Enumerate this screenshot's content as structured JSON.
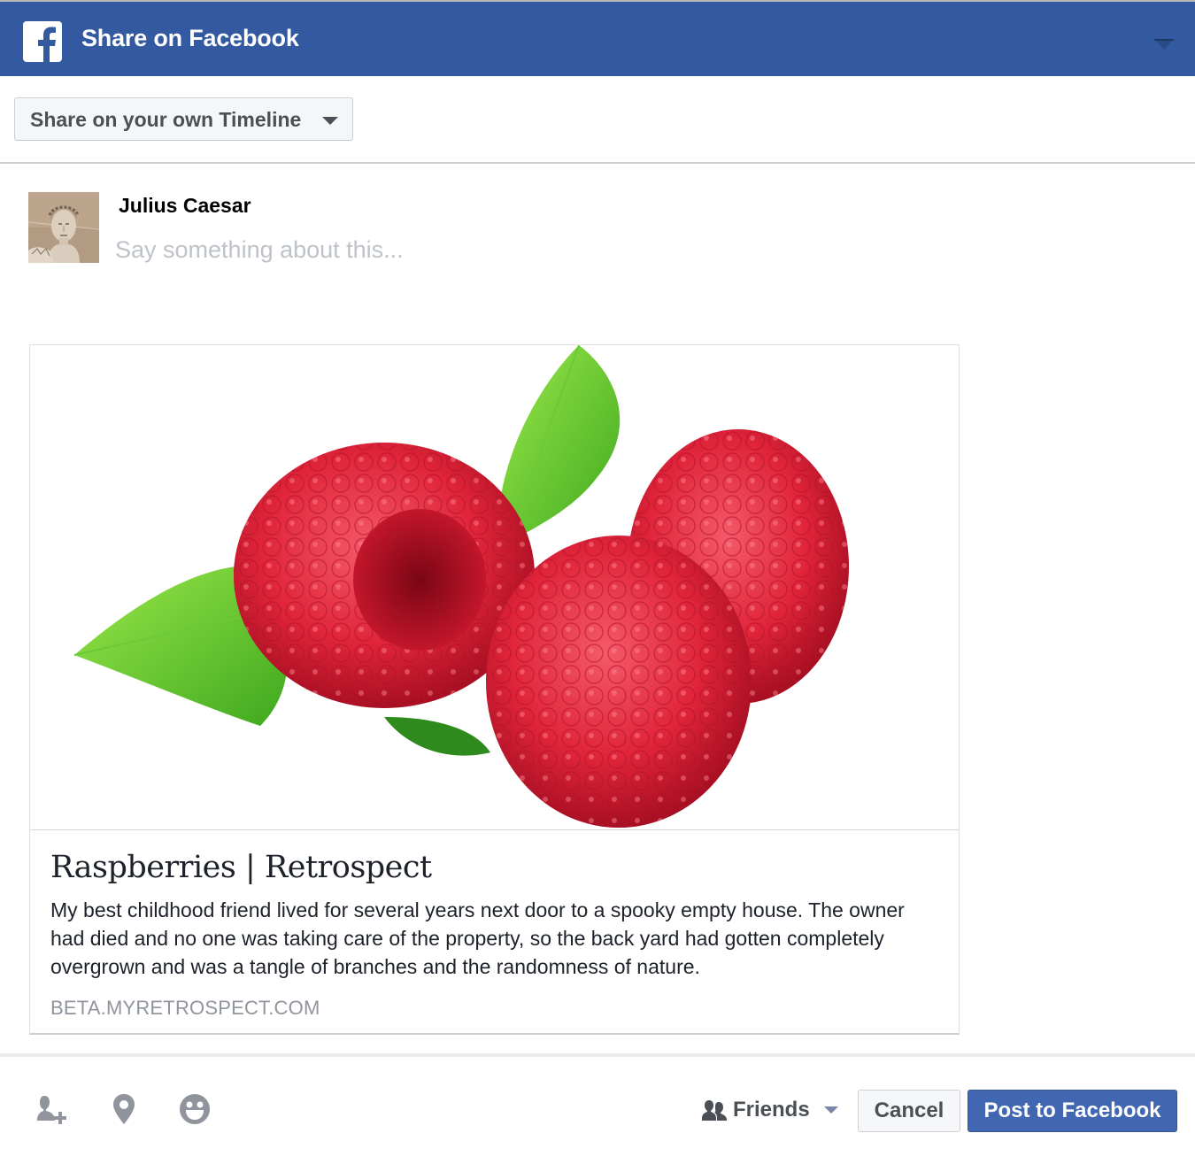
{
  "header": {
    "title": "Share on Facebook",
    "logo_icon": "facebook-logo-icon",
    "menu_icon": "chevron-down-icon",
    "background_color": "#3359a0"
  },
  "share_target": {
    "selected": "Share on your own Timeline",
    "icon": "caret-down-icon"
  },
  "composer": {
    "user_name": "Julius Caesar",
    "avatar_alt": "Julius Caesar statue avatar",
    "message_value": "",
    "message_placeholder": "Say something about this..."
  },
  "link_preview": {
    "image_alt": "Three raspberries with a green leaf",
    "title": "Raspberries | Retrospect",
    "description": "My best childhood friend lived for several years next door to a spooky empty house. The owner had died and no one was taking care of the property, so the back yard had gotten completely overgrown and was a tangle of branches and the randomness of nature.",
    "domain": "BETA.MYRETROSPECT.COM"
  },
  "footer": {
    "icons": [
      {
        "name": "tag-friends-icon"
      },
      {
        "name": "location-pin-icon"
      },
      {
        "name": "feeling-smiley-icon"
      }
    ],
    "audience_label": "Friends",
    "audience_icon": "friends-icon",
    "cancel_label": "Cancel",
    "post_label": "Post to Facebook",
    "post_color": "#4267b2"
  }
}
